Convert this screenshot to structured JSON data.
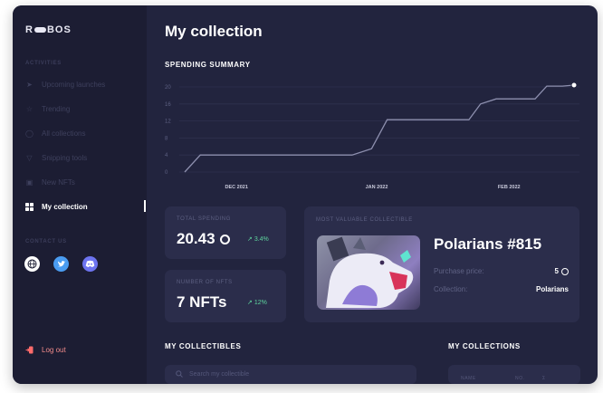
{
  "sidebar": {
    "logo": {
      "left": "R",
      "right": "BOS"
    },
    "activities_label": "ACTIVITIES",
    "items": [
      {
        "label": "Upcoming launches",
        "icon": "rocket-icon"
      },
      {
        "label": "Trending",
        "icon": "star-icon"
      },
      {
        "label": "All collections",
        "icon": "clock-icon"
      },
      {
        "label": "Snipping tools",
        "icon": "funnel-icon"
      },
      {
        "label": "New NFTs",
        "icon": "gift-icon"
      },
      {
        "label": "My collection",
        "icon": "grid-icon",
        "active": true
      }
    ],
    "contact_label": "CONTACT US",
    "socials": [
      {
        "icon": "globe-icon",
        "color": "#ffffff"
      },
      {
        "icon": "twitter-icon",
        "color": "#4a9cf1"
      },
      {
        "icon": "discord-icon",
        "color": "#6d74f0"
      }
    ],
    "logout_label": "Log out"
  },
  "main": {
    "title": "My collection",
    "spending_summary_label": "SPENDING SUMMARY",
    "total_spending": {
      "label": "TOTAL SPENDING",
      "value": "20.43",
      "trend": "3.4%"
    },
    "number_of_nfts": {
      "label": "NUMBER OF NFTS",
      "value": "7 NFTs",
      "trend": "12%"
    },
    "most_valuable": {
      "label": "MOST VALUABLE COLLECTIBLE",
      "name": "Polarians #815",
      "purchase_label": "Purchase price:",
      "purchase_value": "5",
      "collection_label": "Collection:",
      "collection_value": "Polarians"
    },
    "my_collectibles_label": "MY COLLECTIBLES",
    "search_placeholder": "Search my collectible",
    "my_collections_label": "MY COLLECTIONS",
    "collections_columns": [
      "NAME",
      "NO.",
      "Σ"
    ]
  },
  "colors": {
    "accent_green": "#5ed49e",
    "sidebar_bg": "#1c1d33",
    "main_bg": "#22243e",
    "card_bg": "#2b2d4b",
    "logout_red": "#f08a8a"
  },
  "chart_data": {
    "type": "line",
    "title": "SPENDING SUMMARY",
    "x_tick_labels": [
      "DEC 2021",
      "JAN 2022",
      "FEB 2022"
    ],
    "y_ticks": [
      0,
      4,
      8,
      12,
      16,
      20
    ],
    "ylim": [
      0,
      20
    ],
    "grid": true,
    "series": [
      {
        "values": [
          0,
          4,
          4,
          4,
          4,
          4,
          5.5,
          12.3,
          12.3,
          12.3,
          12.3,
          16,
          17.2,
          17.2,
          17.2,
          20.2,
          20.2,
          20.43
        ],
        "x_positions": [
          0,
          0.04,
          0.08,
          0.2,
          0.35,
          0.43,
          0.48,
          0.52,
          0.6,
          0.7,
          0.73,
          0.76,
          0.8,
          0.86,
          0.9,
          0.93,
          0.97,
          1.0
        ]
      }
    ],
    "end_label": "20.43"
  }
}
